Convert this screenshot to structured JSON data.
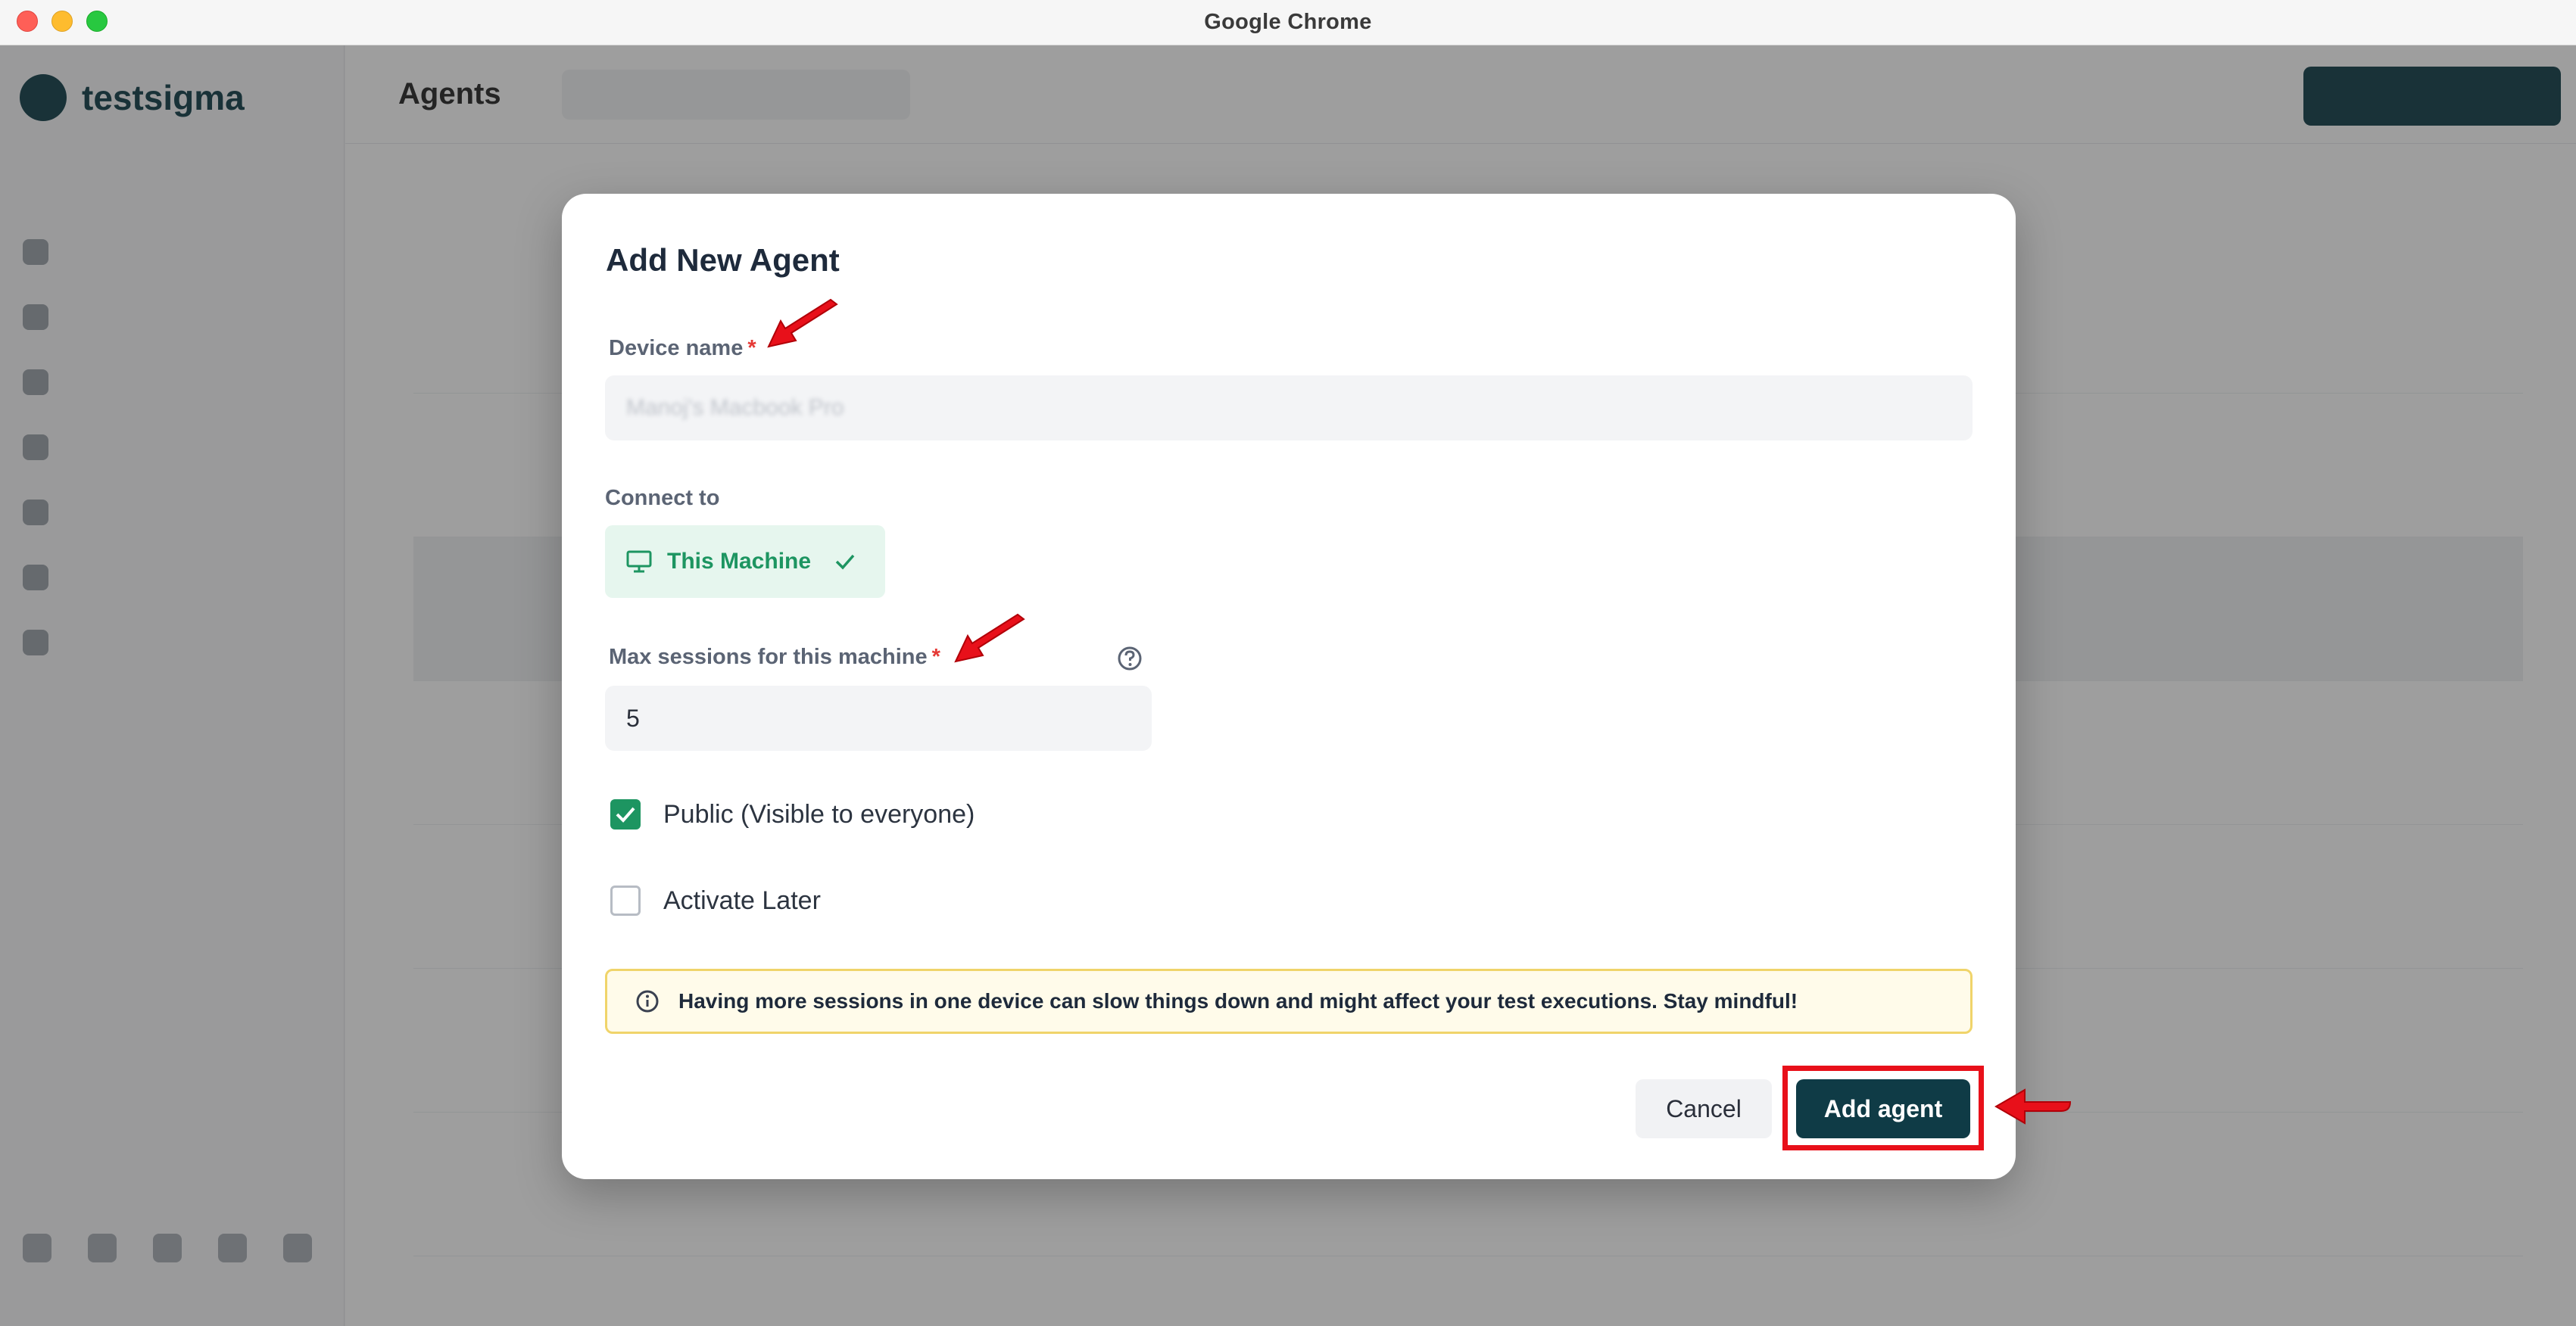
{
  "window": {
    "title": "Google Chrome"
  },
  "background": {
    "brand": "testsigma",
    "page_title": "Agents",
    "sidebar_items": [
      "",
      "",
      "",
      "",
      "",
      "",
      ""
    ]
  },
  "modal": {
    "title": "Add New Agent",
    "device_name": {
      "label": "Device name",
      "required_mark": "*",
      "value": "Manoj's Macbook Pro"
    },
    "connect_to": {
      "label": "Connect to",
      "option_label": "This Machine",
      "option_icon": "monitor-icon",
      "selected_icon": "check-icon"
    },
    "max_sessions": {
      "label": "Max sessions for this machine",
      "required_mark": "*",
      "value": "5",
      "help_icon": "question-circle-icon"
    },
    "public_checkbox": {
      "label": "Public (Visible to everyone)",
      "checked": true
    },
    "activate_later_checkbox": {
      "label": "Activate Later",
      "checked": false
    },
    "notice": {
      "icon": "info-circle-icon",
      "text": "Having more sessions in one device can slow things down and might affect your test executions. Stay mindful!"
    },
    "buttons": {
      "cancel_label": "Cancel",
      "add_label": "Add agent"
    }
  },
  "colors": {
    "accent_green": "#1d9561",
    "primary_button": "#0f3b46",
    "annotation_red": "#e8101a",
    "notice_bg": "#fffbea",
    "notice_border": "#f0d46a"
  }
}
